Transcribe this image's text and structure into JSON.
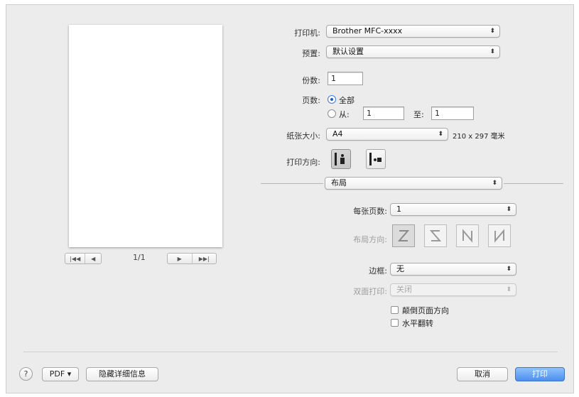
{
  "preview": {
    "page_counter": "1/1",
    "nav_first": "|◀◀",
    "nav_prev": "◀",
    "nav_next": "▶",
    "nav_last": "▶▶|"
  },
  "printer": {
    "label": "打印机:",
    "value": "Brother MFC-xxxx"
  },
  "presets": {
    "label": "预置:",
    "value": "默认设置"
  },
  "copies": {
    "label": "份数:",
    "value": "1"
  },
  "pages": {
    "label": "页数:",
    "all_label": "全部",
    "from_label": "从:",
    "from_value": "1",
    "to_label": "至:",
    "to_value": "1",
    "selected": "all"
  },
  "paper_size": {
    "label": "纸张大小:",
    "value": "A4",
    "dimensions": "210 x 297 毫米"
  },
  "orientation": {
    "label": "打印方向:",
    "selected": "portrait"
  },
  "section_popup": {
    "value": "布局"
  },
  "layout": {
    "pages_per_sheet": {
      "label": "每张页数:",
      "value": "1"
    },
    "layout_direction": {
      "label": "布局方向:"
    },
    "border": {
      "label": "边框:",
      "value": "无"
    },
    "two_sided": {
      "label": "双面打印:",
      "value": "关闭"
    },
    "reverse_orientation": {
      "label": "颠倒页面方向",
      "checked": false
    },
    "flip_horizontally": {
      "label": "水平翻转",
      "checked": false
    }
  },
  "footer": {
    "help": "?",
    "pdf": "PDF ▾",
    "hide_details": "隐藏详细信息",
    "cancel": "取消",
    "print": "打印"
  }
}
